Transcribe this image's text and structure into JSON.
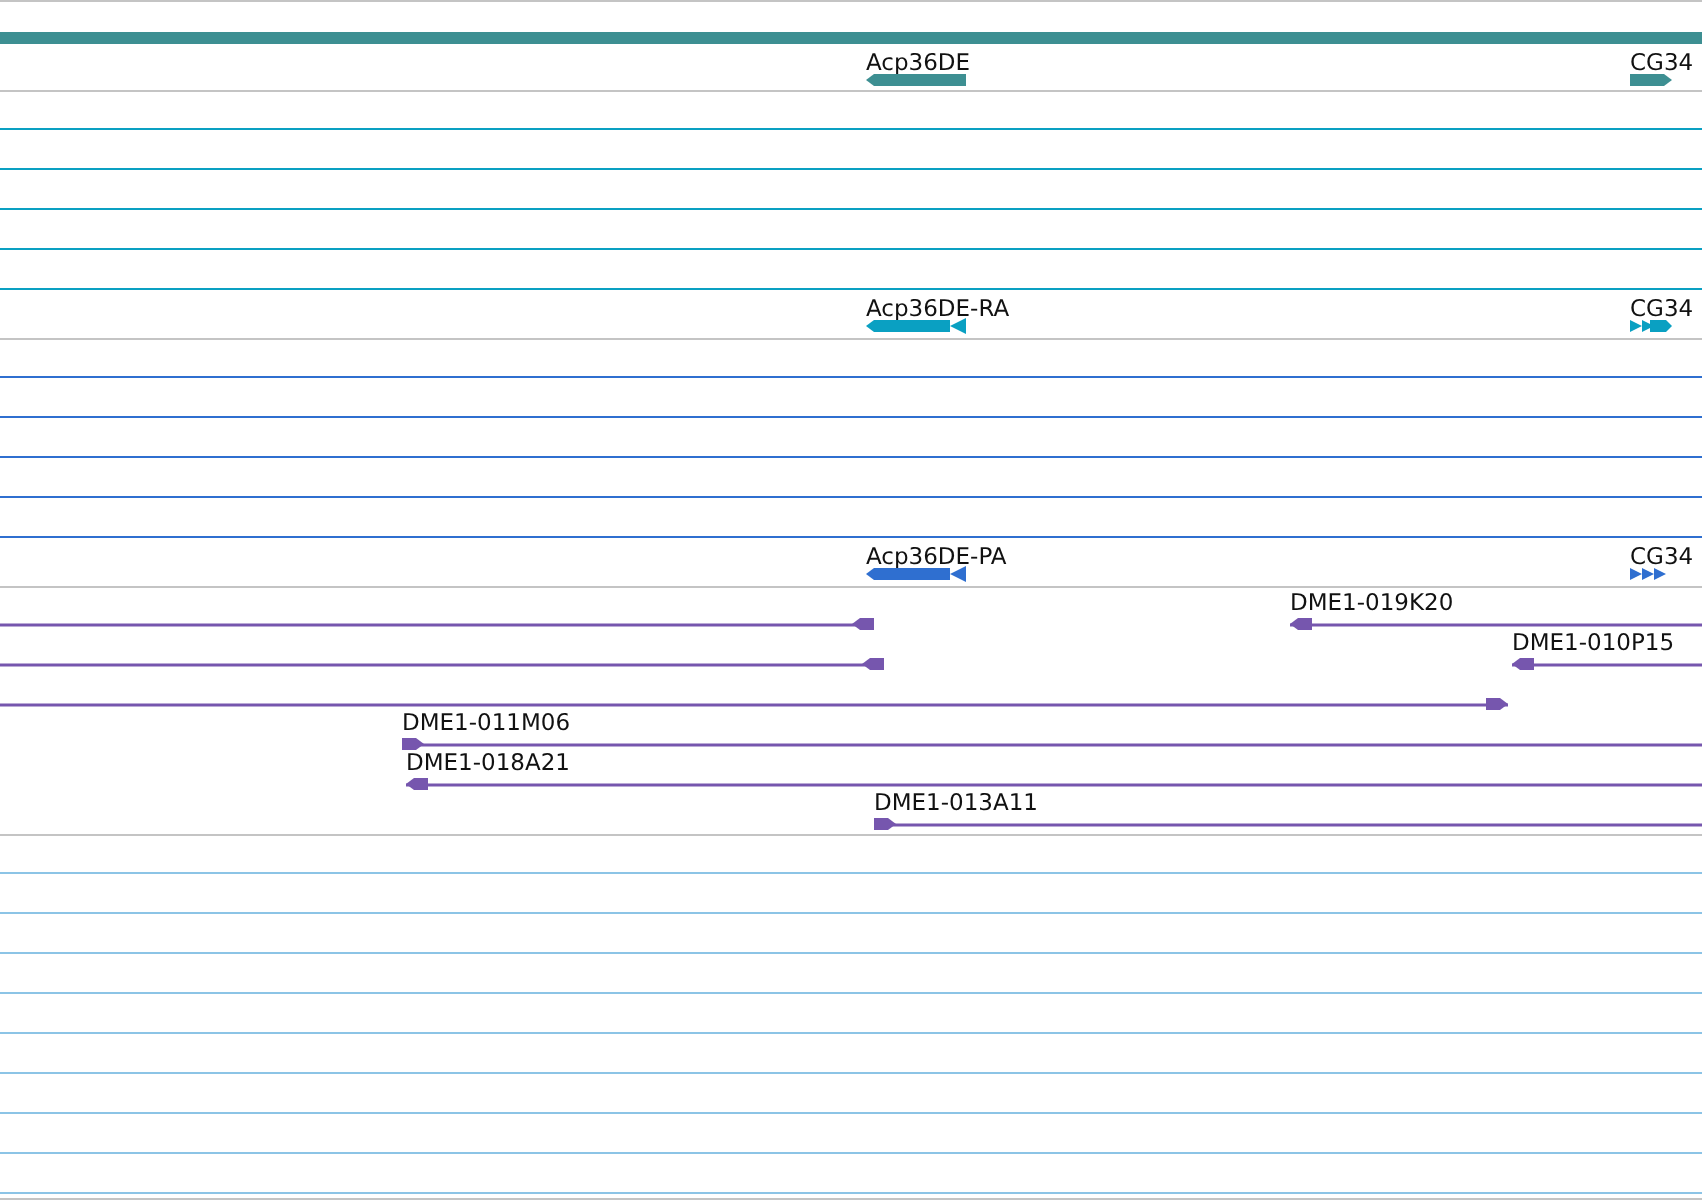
{
  "tracks": [
    {
      "color": "#3d8f92",
      "features": [
        {
          "label": "Acp36DE",
          "reverse": true
        },
        {
          "label": "CG34",
          "reverse": false
        }
      ]
    },
    {
      "color": "#0aa0c2",
      "features": [
        {
          "label": "Acp36DE-RA",
          "reverse": true
        },
        {
          "label": "CG34",
          "reverse": false
        }
      ]
    },
    {
      "color": "#2f6fd0",
      "features": [
        {
          "label": "Acp36DE-PA",
          "reverse": true
        },
        {
          "label": "CG34",
          "reverse": false
        }
      ]
    },
    {
      "color": "#7656ae",
      "clones": [
        {
          "reverse": true
        },
        {
          "label": "DME1-019K20",
          "reverse": true
        },
        {
          "reverse": true
        },
        {
          "label": "DME1-010P15",
          "reverse": true
        },
        {
          "reverse": false
        },
        {
          "label": "DME1-011M06",
          "reverse": false
        },
        {
          "label": "DME1-018A21",
          "reverse": true
        },
        {
          "label": "DME1-013A11",
          "reverse": false
        }
      ]
    },
    {
      "color": "#8cc4e6"
    }
  ]
}
